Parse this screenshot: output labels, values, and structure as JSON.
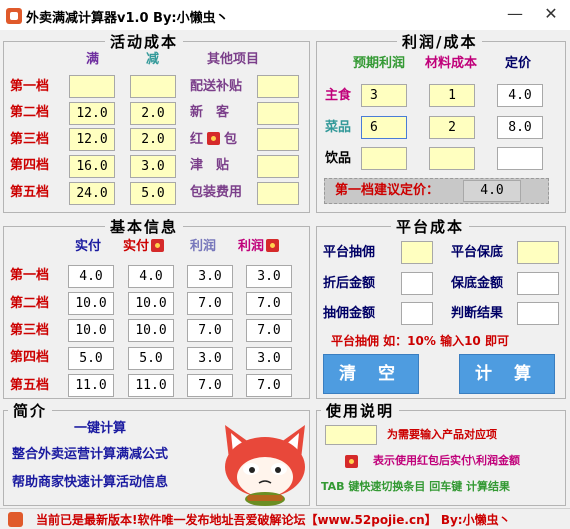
{
  "window": {
    "title": "外卖满减计算器v1.0   By:小懒虫丶",
    "minimize": "—",
    "close": "✕"
  },
  "activity": {
    "title": "活动成本",
    "col_full": "满",
    "col_minus": "减",
    "col_other": "其他项目",
    "rows": [
      {
        "label": "第一档",
        "full": "",
        "minus": ""
      },
      {
        "label": "第二档",
        "full": "12.0",
        "minus": "2.0"
      },
      {
        "label": "第三档",
        "full": "12.0",
        "minus": "2.0"
      },
      {
        "label": "第四档",
        "full": "16.0",
        "minus": "3.0"
      },
      {
        "label": "第五档",
        "full": "24.0",
        "minus": "5.0"
      }
    ],
    "others": [
      {
        "label": "配送补贴",
        "value": ""
      },
      {
        "label": "新　客",
        "value": ""
      },
      {
        "label_a": "红",
        "label_b": "包",
        "value": ""
      },
      {
        "label": "津　贴",
        "value": ""
      },
      {
        "label": "包装费用",
        "value": ""
      }
    ]
  },
  "profit": {
    "title": "利润/成本",
    "col_expected": "预期利润",
    "col_material": "材料成本",
    "col_price": "定价",
    "rows": [
      {
        "label": "主食",
        "expected": "3",
        "material": "1",
        "price": "4.0"
      },
      {
        "label": "菜品",
        "expected": "6",
        "material": "2",
        "price": "8.0"
      },
      {
        "label": "饮品",
        "expected": "",
        "material": "",
        "price": ""
      }
    ],
    "suggest_label": "第一档建议定价：",
    "suggest_value": "4.0"
  },
  "basic": {
    "title": "基本信息",
    "col_actual": "实付",
    "col_actual_rp": "实付",
    "col_profit": "利润",
    "col_profit_rp": "利润",
    "rows": [
      {
        "label": "第一档",
        "actual": "4.0",
        "actual_rp": "4.0",
        "profit": "3.0",
        "profit_rp": "3.0"
      },
      {
        "label": "第二档",
        "actual": "10.0",
        "actual_rp": "10.0",
        "profit": "7.0",
        "profit_rp": "7.0"
      },
      {
        "label": "第三档",
        "actual": "10.0",
        "actual_rp": "10.0",
        "profit": "7.0",
        "profit_rp": "7.0"
      },
      {
        "label": "第四档",
        "actual": "5.0",
        "actual_rp": "5.0",
        "profit": "3.0",
        "profit_rp": "3.0"
      },
      {
        "label": "第五档",
        "actual": "11.0",
        "actual_rp": "11.0",
        "profit": "7.0",
        "profit_rp": "7.0"
      }
    ]
  },
  "platform": {
    "title": "平台成本",
    "commission": "平台抽佣",
    "guarantee": "平台保底",
    "discount_amount": "折后金额",
    "guarantee_amount": "保底金额",
    "commission_amount": "抽佣金额",
    "judge_result": "判断结果",
    "hint": "平台抽佣 如：10% 输入10 即可",
    "clear_button": "清 空",
    "calc_button": "计 算"
  },
  "intro": {
    "title": "简介",
    "line1": "一键计算",
    "line2": "整合外卖运营计算满减公式",
    "line3": "帮助商家快速计算活动信息"
  },
  "usage": {
    "title": "使用说明",
    "item1": "为需要输入产品对应项",
    "item2": "表示使用红包后实付\\利润金额",
    "item3": "TAB 键快速切换条目 回车键 计算结果"
  },
  "status": {
    "text": "当前已是最新版本!软件唯一发布地址吾爱破解论坛【www.52pojie.cn】   By:小懒虫丶"
  },
  "colors": {
    "accent_button": "#4e9ce0",
    "input_yellow": "#ffffc0",
    "red_label": "#cc0000",
    "navy_label": "#1a1aa0"
  }
}
